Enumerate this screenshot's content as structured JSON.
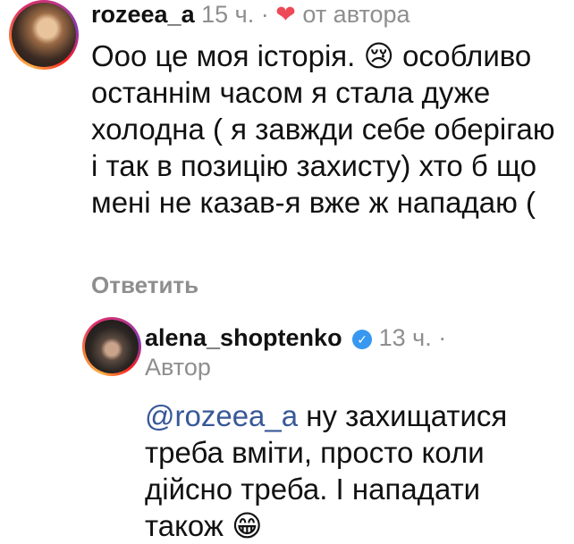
{
  "comment": {
    "username": "rozeea_a",
    "time": "15 ч.",
    "separator": "·",
    "heart": "❤",
    "liked_by_author": "от автора",
    "text": "Ооо це моя історія. 😢 особливо останнім часом я стала дуже холодна ( я завжди себе оберігаю і так в позицію захисту) хто б що мені не казав-я вже ж нападаю (",
    "reply_label": "Ответить"
  },
  "reply": {
    "username": "alena_shoptenko",
    "verified_icon": "✓",
    "time": "13 ч.",
    "separator": "·",
    "author_label": "Автор",
    "mention": "@rozeea_a",
    "text": " ну захищатися треба вміти, просто коли дійсно треба. І нападати також 😁"
  },
  "colors": {
    "heart": "#ed4956",
    "mention": "#385898",
    "verified": "#3897f0",
    "meta": "#8e8e8e"
  }
}
